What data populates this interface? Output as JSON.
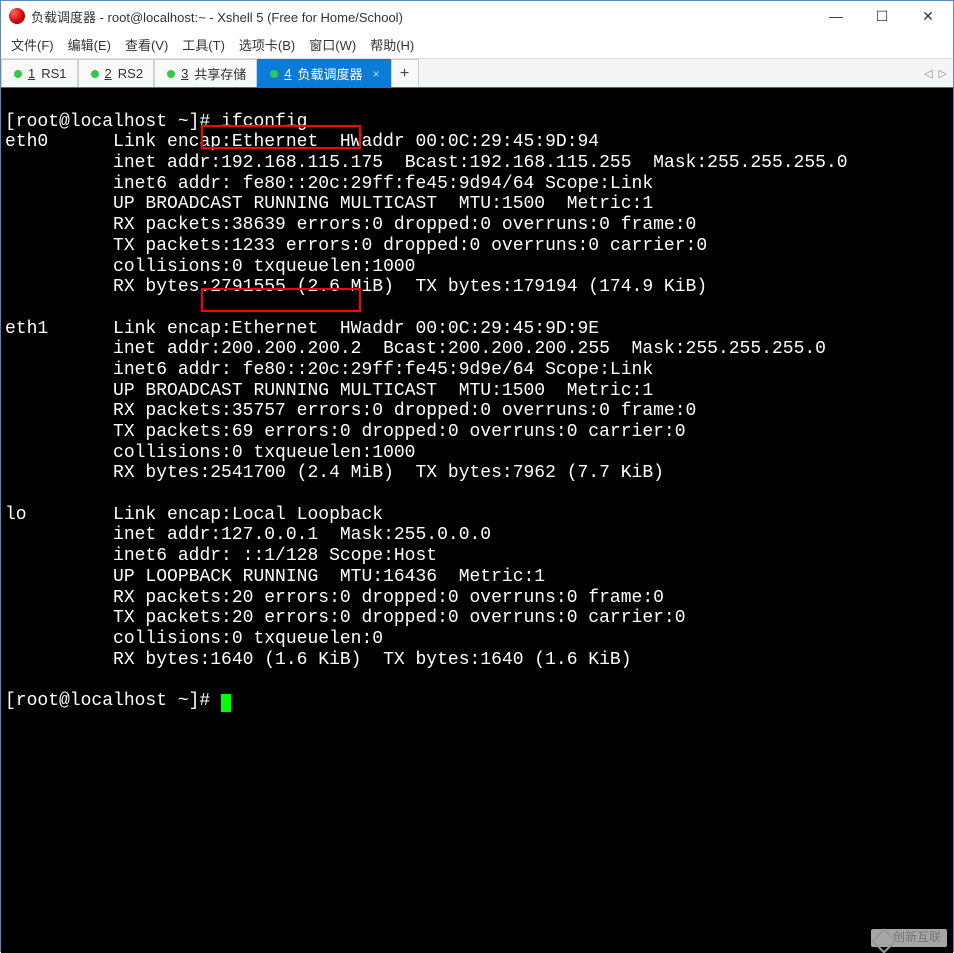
{
  "window": {
    "title": "负载调度器 - root@localhost:~ - Xshell 5 (Free for Home/School)"
  },
  "menus": {
    "file": "文件(F)",
    "edit": "编辑(E)",
    "view": "查看(V)",
    "tools": "工具(T)",
    "tab": "选项卡(B)",
    "window": "窗口(W)",
    "help": "帮助(H)"
  },
  "tabs": [
    {
      "num": "1",
      "label": "RS1",
      "active": false
    },
    {
      "num": "2",
      "label": "RS2",
      "active": false
    },
    {
      "num": "3",
      "label": "共享存储",
      "active": false
    },
    {
      "num": "4",
      "label": "负载调度器",
      "active": true
    }
  ],
  "newtab": "+",
  "terminal": {
    "prompt1": "[root@localhost ~]# ",
    "cmd": "ifconfig",
    "eth0": {
      "name": "eth0",
      "l1": "Link encap:Ethernet  HWaddr 00:0C:29:45:9D:94",
      "l2a": "inet addr:",
      "l2_ip": "192.168.115.175",
      "l2b": "  Bcast:192.168.115.255  Mask:255.255.255.0",
      "l3": "inet6 addr: fe80::20c:29ff:fe45:9d94/64 Scope:Link",
      "l4": "UP BROADCAST RUNNING MULTICAST  MTU:1500  Metric:1",
      "l5": "RX packets:38639 errors:0 dropped:0 overruns:0 frame:0",
      "l6": "TX packets:1233 errors:0 dropped:0 overruns:0 carrier:0",
      "l7": "collisions:0 txqueuelen:1000",
      "l8": "RX bytes:2791555 (2.6 MiB)  TX bytes:179194 (174.9 KiB)"
    },
    "eth1": {
      "name": "eth1",
      "l1": "Link encap:Ethernet  HWaddr 00:0C:29:45:9D:9E",
      "l2a": "inet addr:",
      "l2_ip": "200.200.200.2",
      "l2b": "  Bcast:200.200.200.255  Mask:255.255.255.0",
      "l3": "inet6 addr: fe80::20c:29ff:fe45:9d9e/64 Scope:Link",
      "l4": "UP BROADCAST RUNNING MULTICAST  MTU:1500  Metric:1",
      "l5": "RX packets:35757 errors:0 dropped:0 overruns:0 frame:0",
      "l6": "TX packets:69 errors:0 dropped:0 overruns:0 carrier:0",
      "l7": "collisions:0 txqueuelen:1000",
      "l8": "RX bytes:2541700 (2.4 MiB)  TX bytes:7962 (7.7 KiB)"
    },
    "lo": {
      "name": "lo",
      "l1": "Link encap:Local Loopback",
      "l2": "inet addr:127.0.0.1  Mask:255.0.0.0",
      "l3": "inet6 addr: ::1/128 Scope:Host",
      "l4": "UP LOOPBACK RUNNING  MTU:16436  Metric:1",
      "l5": "RX packets:20 errors:0 dropped:0 overruns:0 frame:0",
      "l6": "TX packets:20 errors:0 dropped:0 overruns:0 carrier:0",
      "l7": "collisions:0 txqueuelen:0",
      "l8": "RX bytes:1640 (1.6 KiB)  TX bytes:1640 (1.6 KiB)"
    },
    "prompt2": "[root@localhost ~]# "
  },
  "highlights": {
    "eth0_ip": "192.168.115.175",
    "eth1_ip": "200.200.200.2"
  },
  "watermark": "创新互联"
}
